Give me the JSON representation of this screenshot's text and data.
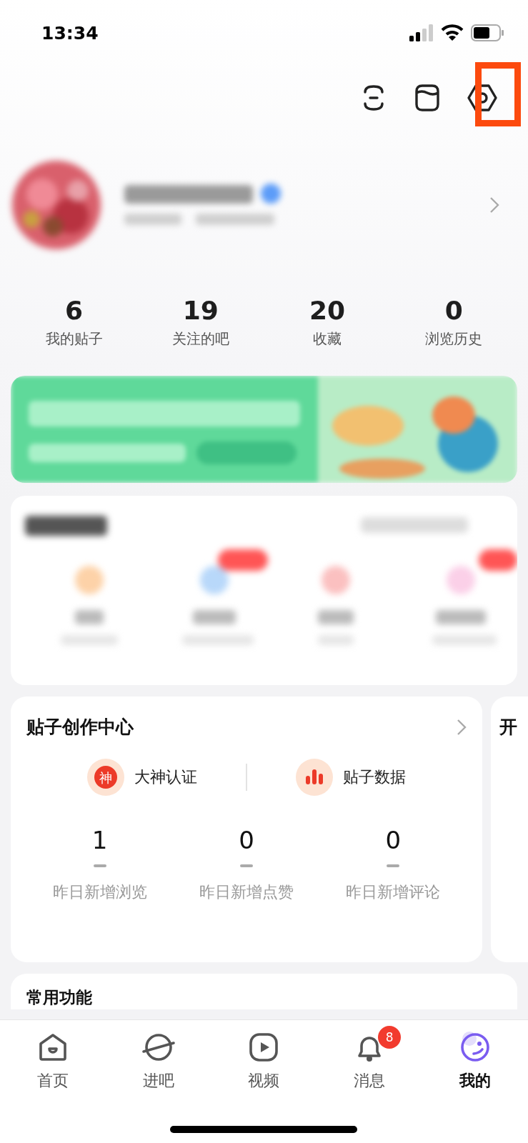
{
  "status_bar": {
    "time": "13:34"
  },
  "stats": [
    {
      "value": "6",
      "label": "我的贴子"
    },
    {
      "value": "19",
      "label": "关注的吧"
    },
    {
      "value": "20",
      "label": "收藏"
    },
    {
      "value": "0",
      "label": "浏览历史"
    }
  ],
  "creation_center": {
    "title": "贴子创作中心",
    "links": [
      {
        "kind": "badge",
        "label": "大神认证",
        "icon_text": "神"
      },
      {
        "kind": "chart",
        "label": "贴子数据"
      }
    ],
    "metrics": [
      {
        "value": "1",
        "label": "昨日新增浏览"
      },
      {
        "value": "0",
        "label": "昨日新增点赞"
      },
      {
        "value": "0",
        "label": "昨日新增评论"
      }
    ]
  },
  "next_card": {
    "title": "开"
  },
  "common_functions": {
    "title": "常用功能"
  },
  "tab_bar": [
    {
      "kind": "home",
      "label": "首页",
      "selected": false
    },
    {
      "kind": "planet",
      "label": "进吧",
      "selected": false
    },
    {
      "kind": "video",
      "label": "视频",
      "selected": false
    },
    {
      "kind": "bell",
      "label": "消息",
      "selected": false,
      "badge": "8"
    },
    {
      "kind": "face",
      "label": "我的",
      "selected": true
    }
  ]
}
